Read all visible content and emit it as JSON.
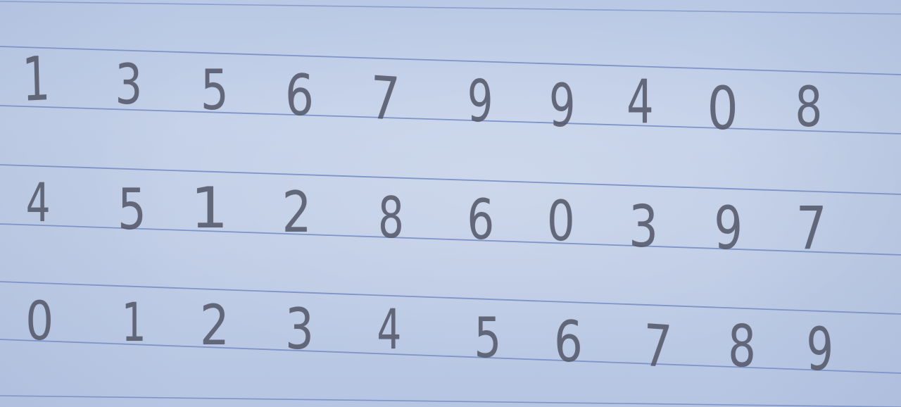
{
  "notebook_page": {
    "rows": [
      {
        "digits": [
          "1",
          "3",
          "5",
          "6",
          "7",
          "9",
          "9",
          "4",
          "0",
          "8"
        ]
      },
      {
        "digits": [
          "4",
          "5",
          "1",
          "2",
          "8",
          "6",
          "0",
          "3",
          "9",
          "7"
        ]
      },
      {
        "digits": [
          "0",
          "1",
          "2",
          "3",
          "4",
          "5",
          "6",
          "7",
          "8",
          "9"
        ]
      }
    ],
    "colors": {
      "paper": "#c0cde6",
      "rule_line": "#7e95c9",
      "pencil": "#55596a"
    }
  }
}
